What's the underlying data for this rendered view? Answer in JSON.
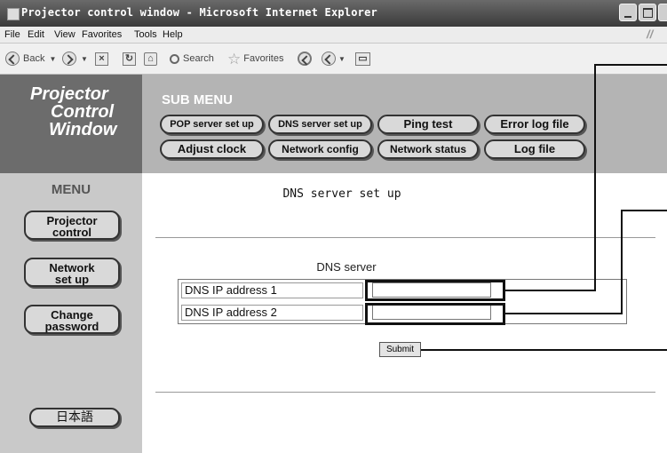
{
  "window": {
    "title": "Projector control window - Microsoft Internet Explorer"
  },
  "menubar": {
    "items": [
      "File",
      "Edit",
      "View",
      "Favorites",
      "Tools",
      "Help"
    ]
  },
  "toolbar": {
    "back_label": "Back",
    "search_label": "Search",
    "favorites_label": "Favorites"
  },
  "logo": {
    "lines": [
      "Projector",
      "Control",
      "Window"
    ]
  },
  "left_menu": {
    "title": "MENU",
    "items": [
      {
        "line1": "Projector",
        "line2": "control"
      },
      {
        "line1": "Network",
        "line2": "set up"
      },
      {
        "line1": "Change",
        "line2": "password"
      }
    ],
    "language_button": "日本語"
  },
  "submenu": {
    "title": "SUB MENU",
    "buttons": [
      "POP server set up",
      "DNS server set up",
      "Ping test",
      "Error log file",
      "Adjust clock",
      "Network config",
      "Network status",
      "Log file"
    ]
  },
  "main": {
    "heading": "DNS server set up",
    "form_title": "DNS server",
    "fields": [
      {
        "label": "DNS IP address 1",
        "value": ""
      },
      {
        "label": "DNS IP address 2",
        "value": ""
      }
    ],
    "submit_label": "Submit"
  },
  "colors": {
    "logo_panel": "#6c6c6c",
    "submenu_panel": "#b4b4b4",
    "menu_panel": "#c9c9c9"
  }
}
